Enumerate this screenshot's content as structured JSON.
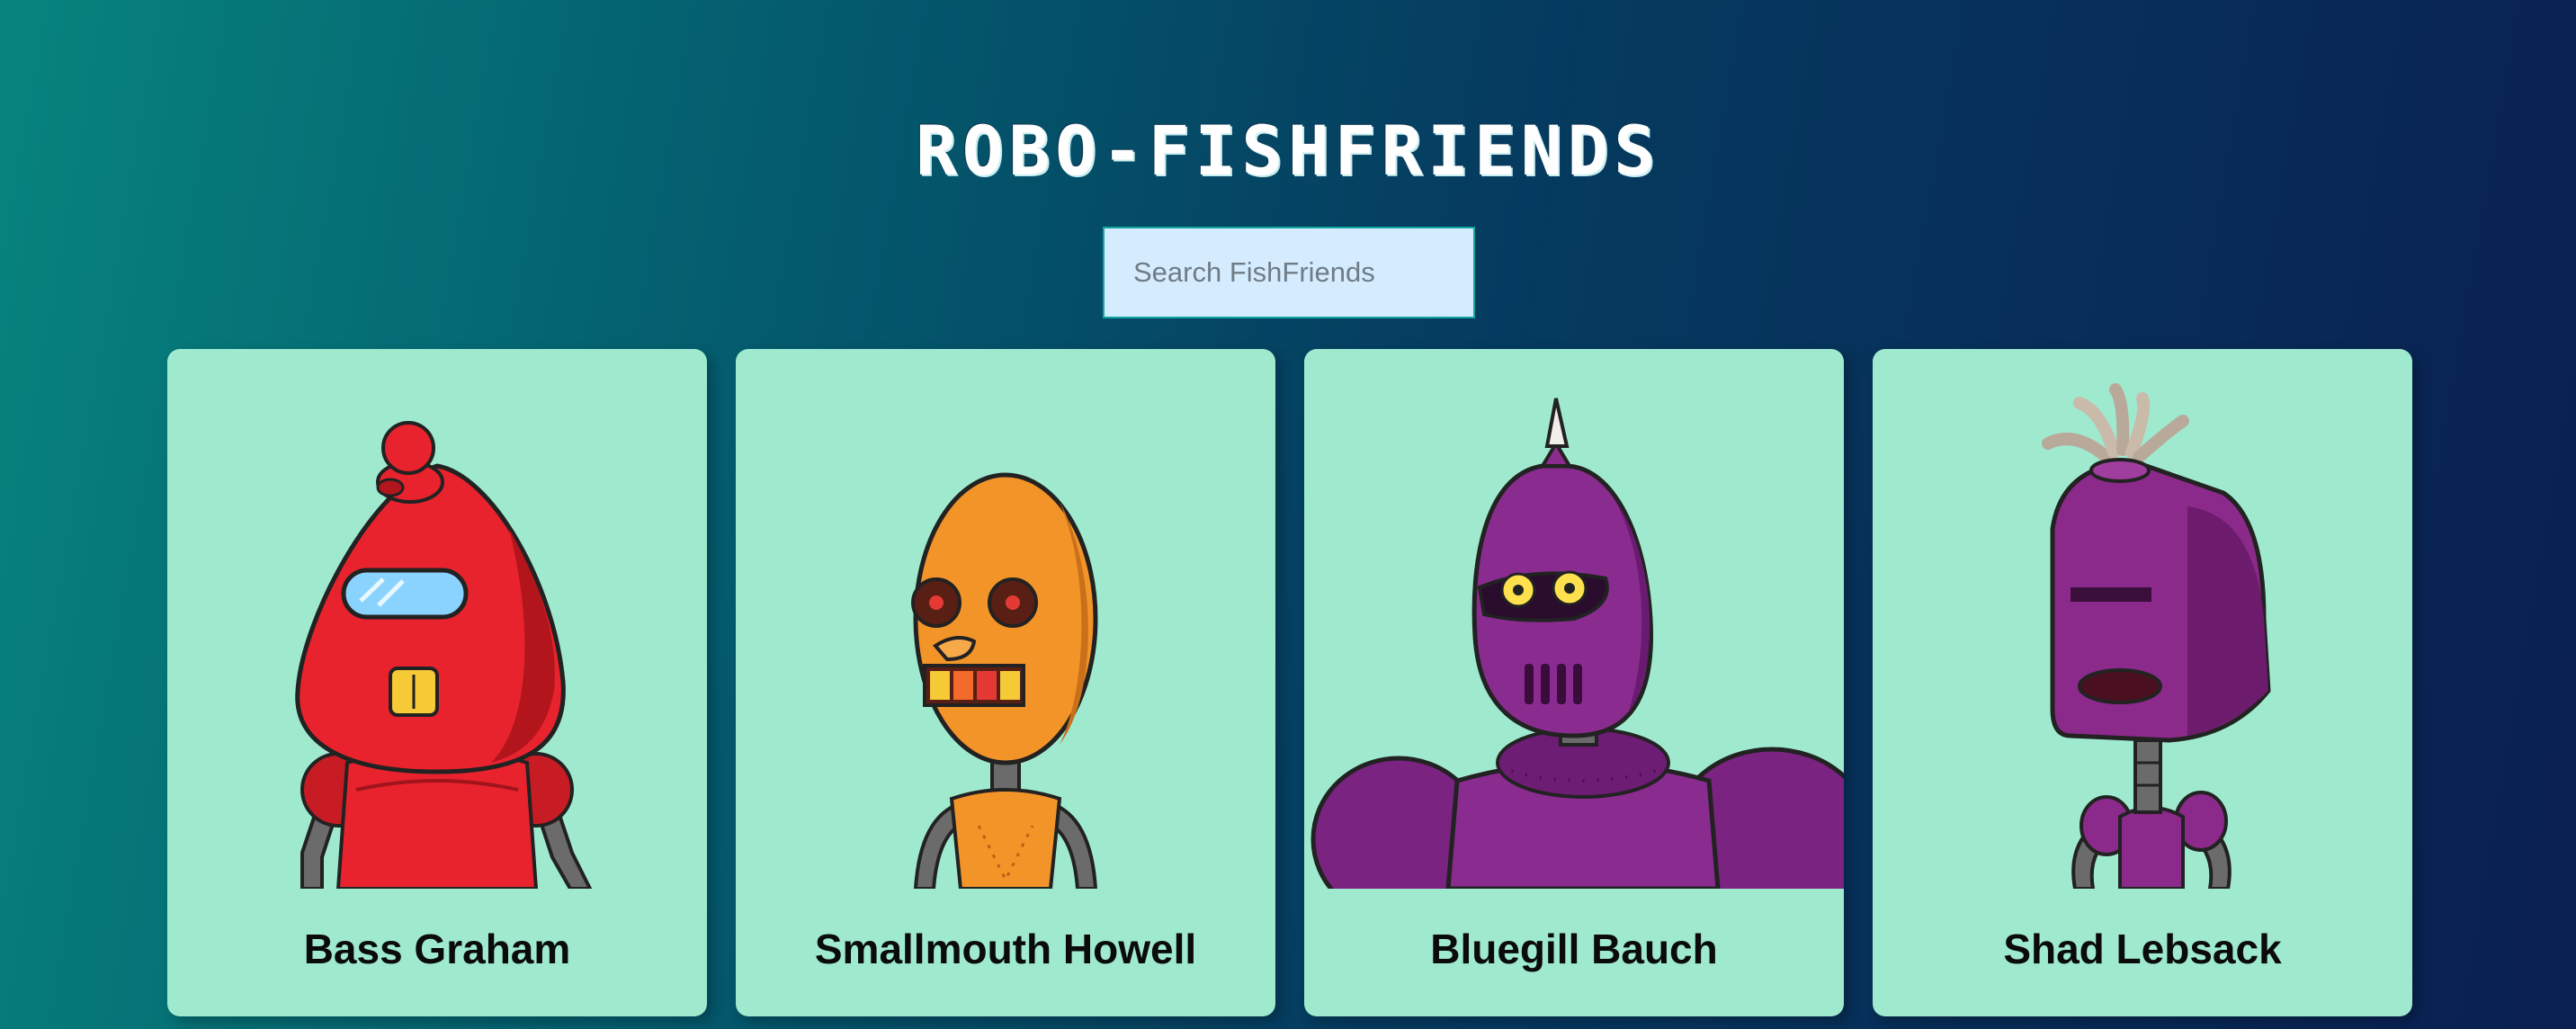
{
  "app": {
    "title": "ROBO-FISHFRIENDS"
  },
  "search": {
    "placeholder": "Search FishFriends",
    "value": ""
  },
  "cards": [
    {
      "name": "Bass Graham",
      "robot_color": "#e8232d"
    },
    {
      "name": "Smallmouth Howell",
      "robot_color": "#f39429"
    },
    {
      "name": "Bluegill Bauch",
      "robot_color": "#8a2c8f"
    },
    {
      "name": "Shad Lebsack",
      "robot_color": "#8b2a8a"
    }
  ],
  "colors": {
    "card_background": "#9feacf",
    "search_background": "#d5ecff",
    "text": "#0b0b0b"
  }
}
